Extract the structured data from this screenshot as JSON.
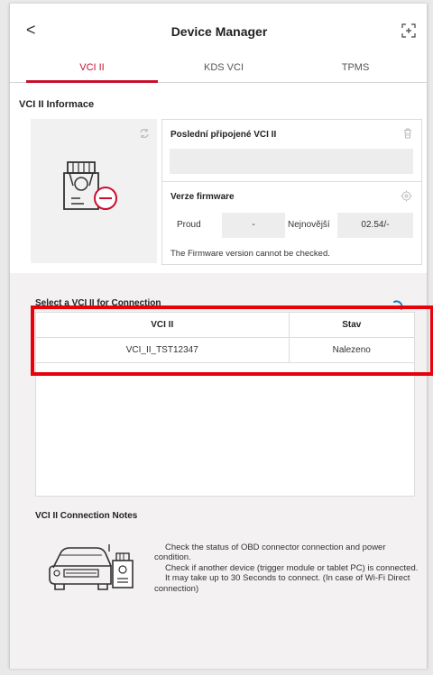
{
  "header": {
    "back_glyph": "<",
    "title": "Device Manager"
  },
  "tabs": [
    {
      "label": "VCI II",
      "active": true
    },
    {
      "label": "KDS VCI",
      "active": false
    },
    {
      "label": "TPMS",
      "active": false
    }
  ],
  "info": {
    "section_title": "VCI II Informace",
    "last_connected_title": "Poslední připojené VCI II",
    "last_connected_value": "",
    "firmware_title": "Verze firmware",
    "current_label": "Proud",
    "current_value": "-",
    "latest_label": "Nejnovější",
    "latest_value": "02.54/-",
    "firmware_note": "The Firmware version cannot be checked."
  },
  "selection": {
    "section_title": "Select a VCI II for Connection",
    "columns": [
      "VCI II",
      "Stav"
    ],
    "rows": [
      {
        "name": "VCI_II_TST12347",
        "status": "Nalezeno"
      }
    ]
  },
  "notes": {
    "section_title": "VCI II Connection Notes",
    "lines": [
      "Check the status of OBD connector connection and power condition.",
      "Check if another device (trigger module or tablet PC) is connected.",
      "It may take up to 30 Seconds to connect. (In case of Wi-Fi Direct connection)"
    ]
  },
  "colors": {
    "accent": "#c8102e",
    "highlight": "#e8000b",
    "spinner": "#1a7fc1"
  },
  "icons": [
    "back-icon",
    "fullscreen-icon",
    "refresh-icon",
    "vci-device-icon",
    "trash-icon",
    "gear-icon",
    "loading-spinner-icon",
    "car-vci-icon"
  ]
}
